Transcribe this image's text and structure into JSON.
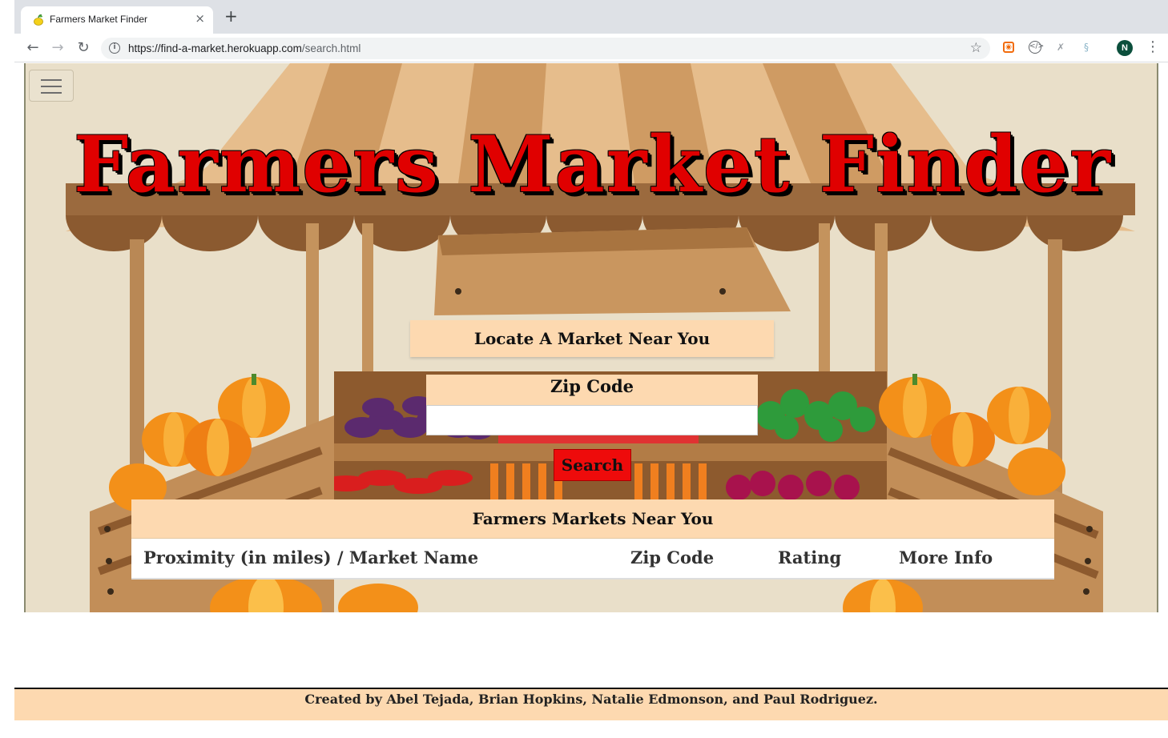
{
  "browser": {
    "tab_title": "Farmers Market Finder",
    "tab_close": "×",
    "new_tab": "+",
    "url_host": "https://find-a-market.herokuapp.com",
    "url_path": "/search.html",
    "profile_initial": "N"
  },
  "page": {
    "title": "Farmers Market Finder",
    "locate_heading": "Locate A Market Near You",
    "zip_label": "Zip Code",
    "zip_value": "",
    "search_button": "Search",
    "results_heading": "Farmers Markets Near You",
    "columns": {
      "proximity": "Proximity (in miles) / Market Name",
      "zip": "Zip Code",
      "rating": "Rating",
      "more_info": "More Info"
    },
    "footer": "Created by Abel Tejada, Brian Hopkins, Natalie Edmonson, and Paul Rodriguez."
  },
  "colors": {
    "accent_red": "#ee0b0b",
    "peach": "#fdd9b0",
    "awning_tan": "#e9bf8e",
    "wood_brown": "#9b6a3e"
  }
}
